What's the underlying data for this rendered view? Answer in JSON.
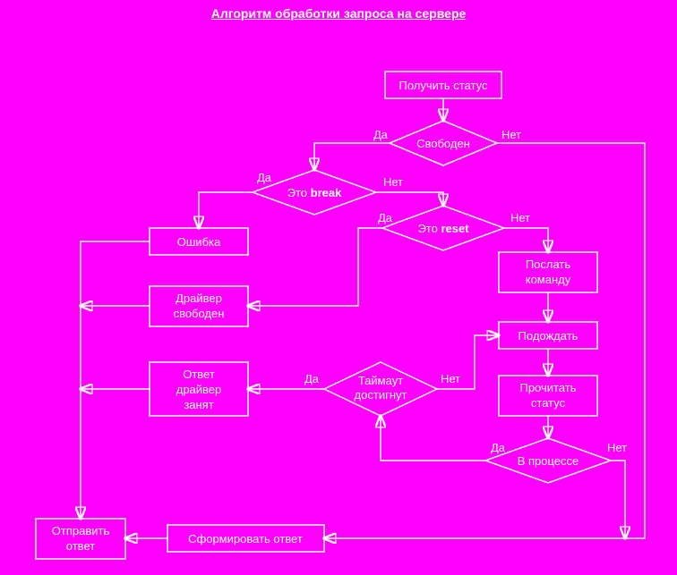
{
  "title": "Алгоритм обработки запроса на сервере",
  "labels": {
    "yes": "Да",
    "no": "Нет"
  },
  "nodes": {
    "get_status": "Получить статус",
    "free": "Свободен",
    "is_break_pre": "Это ",
    "is_break_kw": "break",
    "is_reset_pre": "Это ",
    "is_reset_kw": "reset",
    "error": "Ошибка",
    "driver_free_l1": "Драйвер",
    "driver_free_l2": "свободен",
    "send_cmd_l1": "Послать",
    "send_cmd_l2": "команду",
    "wait": "Подождать",
    "read_status_l1": "Прочитать",
    "read_status_l2": "статус",
    "in_progress": "В процессе",
    "timeout_l1": "Таймаут",
    "timeout_l2": "достигнут",
    "busy_l1": "Ответ",
    "busy_l2": "драйвер",
    "busy_l3": "занят",
    "form_answer": "Сформировать ответ",
    "send_answer_l1": "Отправить",
    "send_answer_l2": "ответ"
  }
}
